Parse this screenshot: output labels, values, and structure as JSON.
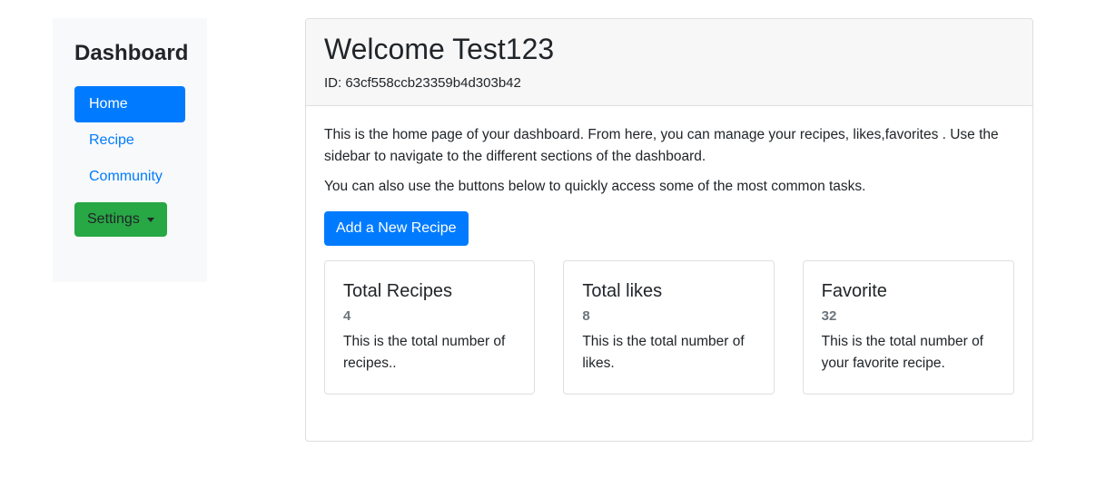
{
  "sidebar": {
    "title": "Dashboard",
    "items": [
      {
        "label": "Home",
        "active": true
      },
      {
        "label": "Recipe"
      },
      {
        "label": "Community"
      }
    ],
    "settings_label": "Settings"
  },
  "header": {
    "welcome": "Welcome Test123",
    "id_text": "ID: 63cf558ccb23359b4d303b42"
  },
  "body": {
    "intro": "This is the home page of your dashboard. From here, you can manage your recipes, likes,favorites . Use the sidebar to navigate to the different sections of the dashboard.",
    "intro2": "You can also use the buttons below to quickly access some of the most common tasks.",
    "add_recipe_label": "Add a New Recipe"
  },
  "stats": [
    {
      "title": "Total Recipes",
      "value": "4",
      "desc": "This is the total number of recipes.."
    },
    {
      "title": "Total likes",
      "value": "8",
      "desc": "This is the total number of likes."
    },
    {
      "title": "Favorite",
      "value": "32",
      "desc": "This is the total number of your favorite recipe."
    }
  ],
  "colors": {
    "primary": "#007bff",
    "success": "#28a745",
    "muted": "#6c757d"
  }
}
